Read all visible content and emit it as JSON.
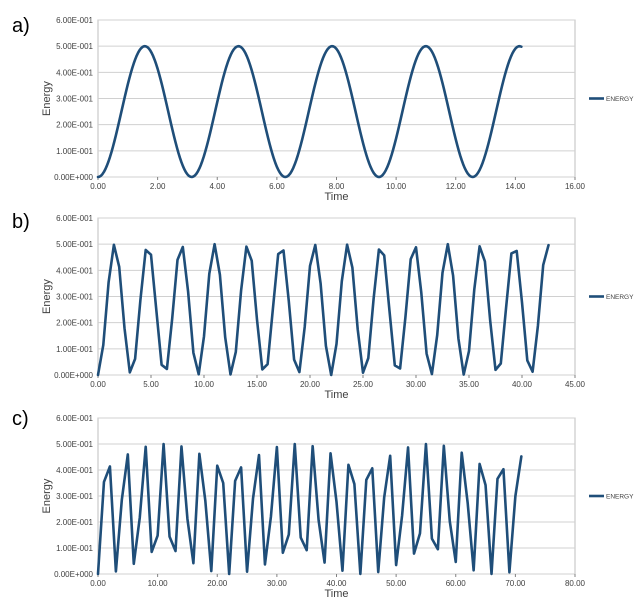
{
  "chart_data": [
    {
      "type": "line",
      "panel_label": "a)",
      "xlabel": "Time",
      "ylabel": "Energy",
      "xlim": [
        0,
        16
      ],
      "ylim": [
        0,
        0.6
      ],
      "xticks": [
        "0.00",
        "2.00",
        "4.00",
        "6.00",
        "8.00",
        "10.00",
        "12.00",
        "14.00",
        "16.00"
      ],
      "yticks": [
        "0.00E+000",
        "1.00E-001",
        "2.00E-001",
        "3.00E-001",
        "4.00E-001",
        "5.00E-001",
        "6.00E-001"
      ],
      "grid": "horizontal",
      "legend": "right",
      "series": [
        {
          "name": "ENERGY",
          "color": "#1f4e79",
          "x_max": 14.2,
          "period": 3.14159,
          "amplitude": 0.5,
          "sample_step": 0.05
        }
      ]
    },
    {
      "type": "line",
      "panel_label": "b)",
      "xlabel": "Time",
      "ylabel": "Energy",
      "xlim": [
        0,
        45
      ],
      "ylim": [
        0,
        0.6
      ],
      "xticks": [
        "0.00",
        "5.00",
        "10.00",
        "15.00",
        "20.00",
        "25.00",
        "30.00",
        "35.00",
        "40.00",
        "45.00"
      ],
      "yticks": [
        "0.00E+000",
        "1.00E-001",
        "2.00E-001",
        "3.00E-001",
        "4.00E-001",
        "5.00E-001",
        "6.00E-001"
      ],
      "grid": "horizontal",
      "legend": "right",
      "series": [
        {
          "name": "ENERGY",
          "color": "#1f4e79",
          "x_max": 42.6,
          "period": 3.14159,
          "amplitude": 0.5,
          "sample_step": 0.5
        }
      ]
    },
    {
      "type": "line",
      "panel_label": "c)",
      "xlabel": "Time",
      "ylabel": "Energy",
      "xlim": [
        0,
        80
      ],
      "ylim": [
        0,
        0.6
      ],
      "xticks": [
        "0.00",
        "10.00",
        "20.00",
        "30.00",
        "40.00",
        "50.00",
        "60.00",
        "70.00",
        "80.00"
      ],
      "yticks": [
        "0.00E+000",
        "1.00E-001",
        "2.00E-001",
        "3.00E-001",
        "4.00E-001",
        "5.00E-001",
        "6.00E-001"
      ],
      "grid": "horizontal",
      "legend": "right",
      "series": [
        {
          "name": "ENERGY",
          "color": "#1f4e79",
          "x_max": 71.0,
          "period": 3.14159,
          "amplitude": 0.5,
          "sample_step": 1.0
        }
      ]
    }
  ]
}
